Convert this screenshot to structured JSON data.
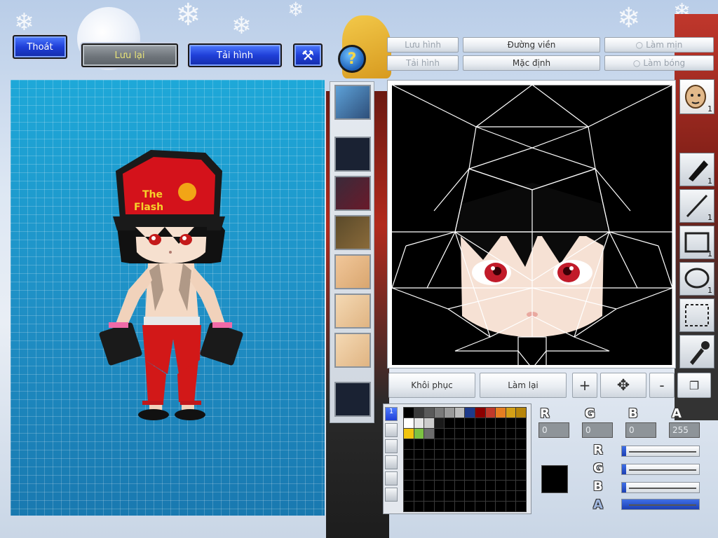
{
  "top_buttons": {
    "exit": "Thoát",
    "save": "Lưu lại",
    "load": "Tải hình",
    "help": "?"
  },
  "editor_controls": {
    "save_image": "Lưu hình",
    "load_image": "Tải hình",
    "outline": "Đường viền",
    "default": "Mặc định",
    "smooth": "Làm mịn",
    "gloss": "Làm bóng"
  },
  "edit_actions": {
    "restore": "Khôi phục",
    "redo": "Làm lại",
    "zoom_in": "+",
    "zoom_out": "-"
  },
  "tools": [
    {
      "name": "face-tool",
      "count": "1"
    },
    {
      "name": "pen-tool",
      "count": "1"
    },
    {
      "name": "line-tool",
      "count": "1"
    },
    {
      "name": "rect-tool",
      "count": "1"
    },
    {
      "name": "ellipse-tool",
      "count": "1"
    },
    {
      "name": "select-tool",
      "count": ""
    },
    {
      "name": "eyedropper-tool",
      "count": ""
    }
  ],
  "palette": {
    "tab_active": "1",
    "row1": [
      "#000000",
      "#3a3a3a",
      "#5a5a5a",
      "#7a7a7a",
      "#9a9a9a",
      "#bdbdbd",
      "#1e3a8a",
      "#8b0000",
      "#c0392b",
      "#e67e22",
      "#d4a017",
      "#b8860b"
    ],
    "row2": [
      "#ffffff",
      "#e6e6e6",
      "#cccccc",
      "#1a1a1a",
      "#000000",
      "#000000",
      "#000000",
      "#000000",
      "#000000",
      "#000000",
      "#000000",
      "#000000"
    ],
    "row3": [
      "#f1c40f",
      "#7cc242",
      "#6c6c6c",
      "#000000",
      "#000000",
      "#000000",
      "#000000",
      "#000000",
      "#000000",
      "#000000",
      "#000000",
      "#000000"
    ]
  },
  "rgba": {
    "r": "0",
    "g": "0",
    "b": "0",
    "a": "255",
    "r_label": "R",
    "g_label": "G",
    "b_label": "B",
    "a_label": "A",
    "r_level": 0,
    "g_level": 0,
    "b_level": 0,
    "a_level": 1,
    "current_color": "#000000"
  },
  "character": {
    "cap_text_line1": "The",
    "cap_text_line2": "Flash"
  },
  "colors": {
    "accent_blue": "#1f3fd8",
    "preview_bg": "#1f8ec4",
    "cap_red": "#d4121b"
  }
}
